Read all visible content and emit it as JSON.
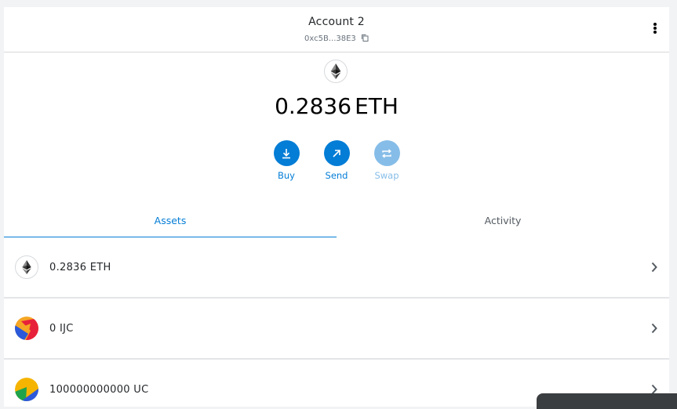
{
  "header": {
    "account_name": "Account 2",
    "address": "0xc5B...38E3",
    "menu_icon": "kebab-menu-icon"
  },
  "balance": {
    "amount": "0.2836",
    "unit": "ETH",
    "icon": "ethereum-logo-icon"
  },
  "actions": {
    "buy_label": "Buy",
    "send_label": "Send",
    "swap_label": "Swap",
    "swap_disabled": true
  },
  "tabs": [
    {
      "label": "Assets",
      "active": true
    },
    {
      "label": "Activity",
      "active": false
    }
  ],
  "assets": [
    {
      "text": "0.2836 ETH",
      "icon": "ethereum-token-icon"
    },
    {
      "text": "0 IJC",
      "icon": "ijc-token-icon"
    },
    {
      "text": "100000000000 UC",
      "icon": "uc-token-icon"
    }
  ],
  "colors": {
    "accent": "#037dd6",
    "accent_disabled": "#86bde8",
    "text": "#24272a",
    "muted": "#6a737d"
  }
}
